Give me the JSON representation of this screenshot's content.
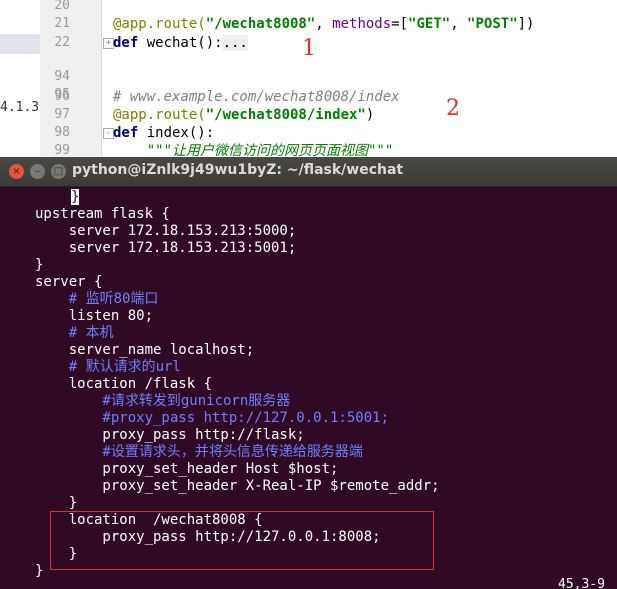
{
  "editor": {
    "side_label": "4.1.3",
    "lines": [
      {
        "num": "20",
        "segments": []
      },
      {
        "num": "21",
        "segments": [
          {
            "cls": "deco",
            "text": "@app.route("
          },
          {
            "cls": "str",
            "text": "\"/wechat8008\""
          },
          {
            "cls": "fn",
            "text": ", "
          },
          {
            "cls": "param",
            "text": "methods"
          },
          {
            "cls": "fn",
            "text": "=["
          },
          {
            "cls": "str",
            "text": "\"GET\""
          },
          {
            "cls": "fn",
            "text": ", "
          },
          {
            "cls": "str",
            "text": "\"POST\""
          },
          {
            "cls": "fn",
            "text": "])"
          }
        ]
      },
      {
        "num": "22",
        "fold": "+",
        "segments": [
          {
            "cls": "kw",
            "text": "def "
          },
          {
            "cls": "fn",
            "text": "wechat():"
          },
          {
            "cls": "ellip",
            "text": "..."
          }
        ]
      },
      {
        "num": "94",
        "segments": []
      },
      {
        "num": "95",
        "segments": []
      },
      {
        "num": "96",
        "segments": [
          {
            "cls": "cmt",
            "text": "# www.example.com/wechat8008/index"
          }
        ]
      },
      {
        "num": "97",
        "segments": [
          {
            "cls": "deco",
            "text": "@app.route("
          },
          {
            "cls": "str",
            "text": "\"/wechat8008/index\""
          },
          {
            "cls": "fn",
            "text": ")"
          }
        ]
      },
      {
        "num": "98",
        "fold": "-",
        "segments": [
          {
            "cls": "kw",
            "text": "def "
          },
          {
            "cls": "fn",
            "text": "index():"
          }
        ]
      },
      {
        "num": "99",
        "segments": [
          {
            "cls": "doc",
            "text": "    \"\"\"让用户微信访问的网页页面视图\"\"\""
          }
        ]
      }
    ],
    "annotation_1": "1",
    "annotation_2": "2"
  },
  "terminal": {
    "title": "python@iZnlk9j49wu1byZ: ~/flask/wechat",
    "buttons": {
      "close": "×",
      "minimize": "–",
      "maximize": "□"
    },
    "cursor_char": "}",
    "lines": [
      {
        "text": "upstream flask {",
        "comment": false
      },
      {
        "text": "    server 172.18.153.213:5000;",
        "comment": false
      },
      {
        "text": "    server 172.18.153.213:5001;",
        "comment": false
      },
      {
        "text": "}",
        "comment": false
      },
      {
        "text": "server {",
        "comment": false
      },
      {
        "text": "    # 监听80端口",
        "comment": true
      },
      {
        "text": "    listen 80;",
        "comment": false
      },
      {
        "text": "    # 本机",
        "comment": true
      },
      {
        "text": "    server_name localhost;",
        "comment": false
      },
      {
        "text": "    # 默认请求的url",
        "comment": true
      },
      {
        "text": "    location /flask {",
        "comment": false
      },
      {
        "text": "        #请求转发到gunicorn服务器",
        "comment": true
      },
      {
        "text": "        #proxy_pass http://127.0.0.1:5001;",
        "comment": true
      },
      {
        "text": "        proxy_pass http://flask;",
        "comment": false
      },
      {
        "text": "        #设置请求头，并将头信息传递给服务器端",
        "comment": true
      },
      {
        "text": "        proxy_set_header Host $host;",
        "comment": false
      },
      {
        "text": "        proxy_set_header X-Real-IP $remote_addr;",
        "comment": false
      },
      {
        "text": "    }",
        "comment": false
      },
      {
        "text": "    location  /wechat8008 {",
        "comment": false
      },
      {
        "text": "        proxy_pass http://127.0.0.1:8008;",
        "comment": false
      },
      {
        "text": "    }",
        "comment": false
      },
      {
        "text": "}",
        "comment": false
      }
    ],
    "status_position": "45,3-9"
  }
}
